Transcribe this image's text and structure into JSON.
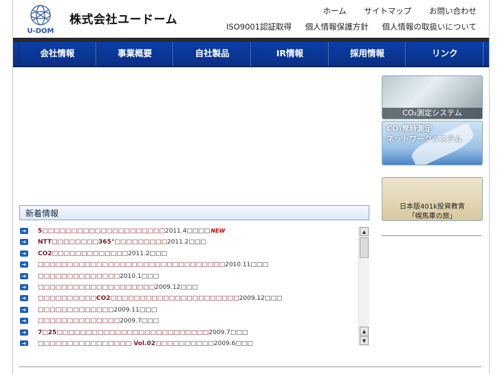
{
  "header": {
    "logo_text": "U-DOM",
    "company_name": "株式会社ユードーム",
    "top_links": [
      "ホーム",
      "サイトマップ",
      "お問い合わせ"
    ],
    "sub_links": [
      "ISO9001認証取得",
      "個人情報保護方針",
      "個人情報の取扱いについて"
    ]
  },
  "nav": {
    "items": [
      "会社情報",
      "事業概要",
      "自社製品",
      "IR情報",
      "採用情報",
      "リンク"
    ]
  },
  "news": {
    "title": "新着情報",
    "items": [
      {
        "title": "5□□□□□□□□□□□□□□□□□□□□□",
        "date": "2011.4□□□□",
        "new": "NEW"
      },
      {
        "title": "NTT□□□□□□□□365°□□□□□□□□□",
        "date": "2011.2□□□"
      },
      {
        "title": "CO2□□□□□□□□□□□□□",
        "date": "2011.2□□□"
      },
      {
        "title": "□□□□□□□□□□□□□□□□□□□□□□□□□□□□□□□□",
        "date": "2010.11□□□"
      },
      {
        "title": "□□□□□□□□□□□□□□",
        "date": "2010.1□□□"
      },
      {
        "title": "□□□□□□□□□□□□□□□□□□□□",
        "date": "2009.12□□□"
      },
      {
        "title": "□□□□□□□□□□CO2□□□□□□□□□□□□□□□□□□□□□□",
        "date": "2009.12□□□"
      },
      {
        "title": "□□□□□□□□□□□□□",
        "date": "2009.11□□□"
      },
      {
        "title": "□□□□□□□□□□□□□□",
        "date": "2009.7□□□"
      },
      {
        "title": "7□25□□□□□□□□□□□□□□□□□□□□□□□□□□",
        "date": "2009.7□□□"
      },
      {
        "title": "□□□□□□□□□□□□□□□□ Vol.02□□□□□□□□□□",
        "date": "2009.6□□□"
      }
    ]
  },
  "banners": {
    "co2_measure": "CO₂測定システム",
    "co2_network_1": "CO₂常時測定",
    "co2_network_2": "ネットワークシステム",
    "k401_1": "日本版401k投資教育",
    "k401_2": "「幌馬車の旅」"
  },
  "colors": {
    "nav_blue": "#0a3fa8",
    "news_title_red": "#7a1620",
    "new_badge": "#c80000"
  }
}
